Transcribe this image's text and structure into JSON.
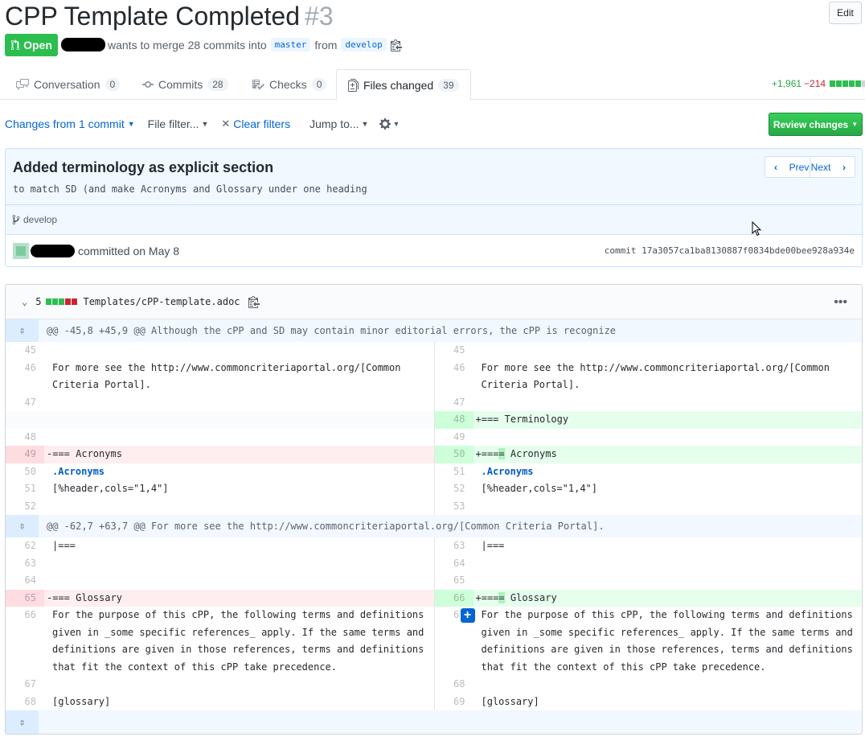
{
  "pr": {
    "title": "CPP Template Completed",
    "number": "#3",
    "edit_label": "Edit",
    "state_label": "Open",
    "merge_text": "wants to merge 28 commits into",
    "base_branch": "master",
    "from_text": "from",
    "head_branch": "develop"
  },
  "tabs": [
    {
      "label": "Conversation",
      "count": "0",
      "icon": "comment-icon"
    },
    {
      "label": "Commits",
      "count": "28",
      "icon": "commit-icon"
    },
    {
      "label": "Checks",
      "count": "0",
      "icon": "checklist-icon"
    },
    {
      "label": "Files changed",
      "count": "39",
      "icon": "file-diff-icon"
    }
  ],
  "diffstat": {
    "additions": "+1,961",
    "deletions": "−214"
  },
  "toolbar": {
    "changes_from": "Changes from",
    "commit_count": "1 commit",
    "file_filter": "File filter...",
    "clear_filters": "Clear filters",
    "jump_to": "Jump to...",
    "review_changes": "Review changes"
  },
  "commit": {
    "title": "Added terminology as explicit section",
    "description": "to match SD (and make Acronyms and Glossary under one heading",
    "prev_label": "Prev",
    "next_label": "Next",
    "branch": "develop",
    "committed_text": "committed on May 8",
    "sha_label": "commit 17a3057ca1ba8130887f0834bde00bee928a934e"
  },
  "file": {
    "change_count": "5",
    "path": "Templates/cPP-template.adoc",
    "hunk1": "@@ -45,8 +45,9 @@ Although the cPP and SD may contain minor editorial errors, the cPP is recognize",
    "hunk2": "@@ -62,7 +63,7 @@ For more see the http://www.commoncriteriaportal.org/[Common Criteria Portal].",
    "lines": {
      "l45": "45",
      "r45": "45",
      "l46": "46",
      "r46": "46",
      "more_see": "For more see the http://www.commoncriteriaportal.org/[Common\nCriteria Portal].",
      "l47": "47",
      "r47": "47",
      "r48": "48",
      "terminology": "+=== Terminology",
      "l48": "48",
      "r49": "49",
      "l49": "49",
      "acronyms_old": "-=== Acronyms",
      "r50": "50",
      "acronyms_new_a": "+===",
      "acronyms_new_b": "=",
      "acronyms_new_c": " Acronyms",
      "l50": "50",
      "r51": "51",
      "acr_dot": ".Acronyms",
      "l51": "51",
      "r52": "52",
      "header_cols": "[%header,cols=\"1,4\"]",
      "l52": "52",
      "r53": "53",
      "l62": "62",
      "r63": "63",
      "table_end": "|===",
      "l63": "63",
      "r64": "64",
      "l64": "64",
      "r65": "65",
      "l65": "65",
      "glossary_old": "-=== Glossary",
      "r66": "66",
      "glossary_new_a": "+===",
      "glossary_new_b": "=",
      "glossary_new_c": " Glossary",
      "l66": "66",
      "r67": "67",
      "purpose": "For the purpose of this cPP, the following terms and definitions\ngiven in _some specific references_ apply. If the same terms and\ndefinitions are given in those references, terms and definitions\nthat fit the context of this cPP take precedence.",
      "l67": "67",
      "r68": "68",
      "l68": "68",
      "r69": "69",
      "glossary_tag": "[glossary]"
    }
  },
  "colors": {
    "green": "#28a745",
    "red": "#cb2431",
    "link": "#0366d6"
  }
}
